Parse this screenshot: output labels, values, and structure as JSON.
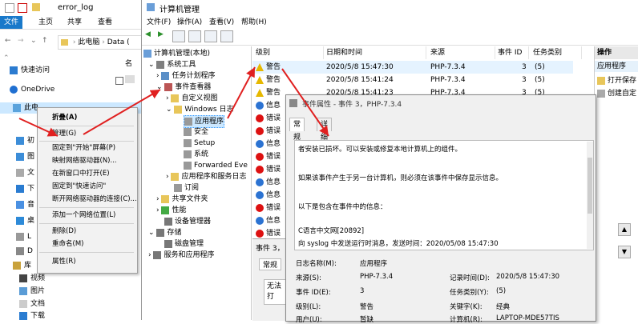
{
  "explorer": {
    "title": "error_log",
    "ribbon_tabs": [
      "文件",
      "主页",
      "共享",
      "查看"
    ],
    "breadcrumb": [
      "此电脑",
      "Data ("
    ],
    "name_header": "名",
    "nav": [
      "快速访问",
      "OneDrive",
      "此电",
      "视频",
      "图片",
      "文档",
      "下载",
      "库"
    ],
    "nav_partial": [
      "初",
      "图",
      "文",
      "下",
      "音",
      "桌",
      "L",
      "D"
    ]
  },
  "context_menu": {
    "items": [
      "折叠(A)",
      "管理(G)",
      "固定到\"开始\"屏幕(P)",
      "映射网络驱动器(N)...",
      "在新窗口中打开(E)",
      "固定到\"快速访问\"",
      "断开网络驱动器的连接(C)...",
      "添加一个网络位置(L)",
      "删除(D)",
      "重命名(M)",
      "属性(R)"
    ]
  },
  "compmgmt": {
    "title": "计算机管理",
    "menu": [
      "文件(F)",
      "操作(A)",
      "查看(V)",
      "帮助(H)"
    ],
    "tree": [
      "计算机管理(本地)",
      "系统工具",
      "任务计划程序",
      "事件查看器",
      "自定义视图",
      "Windows 日志",
      "应用程序",
      "安全",
      "Setup",
      "系统",
      "Forwarded Eve",
      "应用程序和服务日志",
      "订阅",
      "共享文件夹",
      "性能",
      "设备管理器",
      "存储",
      "磁盘管理",
      "服务和应用程序"
    ],
    "list_headers": [
      "级别",
      "日期和时间",
      "来源",
      "事件 ID",
      "任务类别"
    ],
    "rows": [
      {
        "level": "警告",
        "date": "2020/5/8 15:47:30",
        "source": "PHP-7.3.4",
        "id": "3",
        "cat": "(5)"
      },
      {
        "level": "警告",
        "date": "2020/5/8 15:41:24",
        "source": "PHP-7.3.4",
        "id": "3",
        "cat": "(5)"
      },
      {
        "level": "警告",
        "date": "2020/5/8 15:41:23",
        "source": "PHP-7.3.4",
        "id": "3",
        "cat": "(5)"
      },
      {
        "level": "信息",
        "date": "",
        "source": "",
        "id": "",
        "cat": ""
      },
      {
        "level": "错误",
        "date": "",
        "source": "",
        "id": "",
        "cat": ""
      },
      {
        "level": "错误",
        "date": "",
        "source": "",
        "id": "",
        "cat": ""
      },
      {
        "level": "信息",
        "date": "",
        "source": "",
        "id": "",
        "cat": ""
      },
      {
        "level": "错误",
        "date": "",
        "source": "",
        "id": "",
        "cat": ""
      },
      {
        "level": "错误",
        "date": "",
        "source": "",
        "id": "",
        "cat": ""
      },
      {
        "level": "信息",
        "date": "",
        "source": "",
        "id": "",
        "cat": ""
      },
      {
        "level": "信息",
        "date": "",
        "source": "",
        "id": "",
        "cat": ""
      },
      {
        "level": "错误",
        "date": "",
        "source": "",
        "id": "",
        "cat": ""
      },
      {
        "level": "信息",
        "date": "",
        "source": "",
        "id": "",
        "cat": ""
      },
      {
        "level": "错误",
        "date": "",
        "source": "",
        "id": "",
        "cat": ""
      }
    ],
    "actions_header": "操作",
    "actions_sub": "应用程序",
    "actions": [
      "打开保存",
      "创建自定"
    ],
    "lower_title": "事件 3，",
    "lower_tab": "常规",
    "lower_text": "无法打"
  },
  "dialog": {
    "title": "事件属性 - 事件 3，PHP-7.3.4",
    "tabs": [
      "常规",
      "详细信息"
    ],
    "desc_lines": [
      "者安装已损坏。可以安装或修复本地计算机上的组件。",
      "如果该事件产生于另一台计算机，则必须在该事件中保存显示信息。",
      "以下是包含在事件中的信息：",
      "C语言中文网[20892]",
      "向 syslog 中发送运行时消息，发送时间：2020/05/08 15:47:30"
    ],
    "fields": {
      "log_name_label": "日志名称(M):",
      "log_name": "应用程序",
      "source_label": "来源(S):",
      "source": "PHP-7.3.4",
      "logged_label": "记录时间(D):",
      "logged": "2020/5/8 15:47:30",
      "event_id_label": "事件 ID(E):",
      "event_id": "3",
      "task_label": "任务类别(Y):",
      "task": "(5)",
      "level_label": "级别(L):",
      "level": "警告",
      "keywords_label": "关键字(K):",
      "keywords": "经典",
      "user_label": "用户(U):",
      "user": "暂缺",
      "computer_label": "计算机(R):",
      "computer": "LAPTOP-MDE57TIS"
    }
  }
}
